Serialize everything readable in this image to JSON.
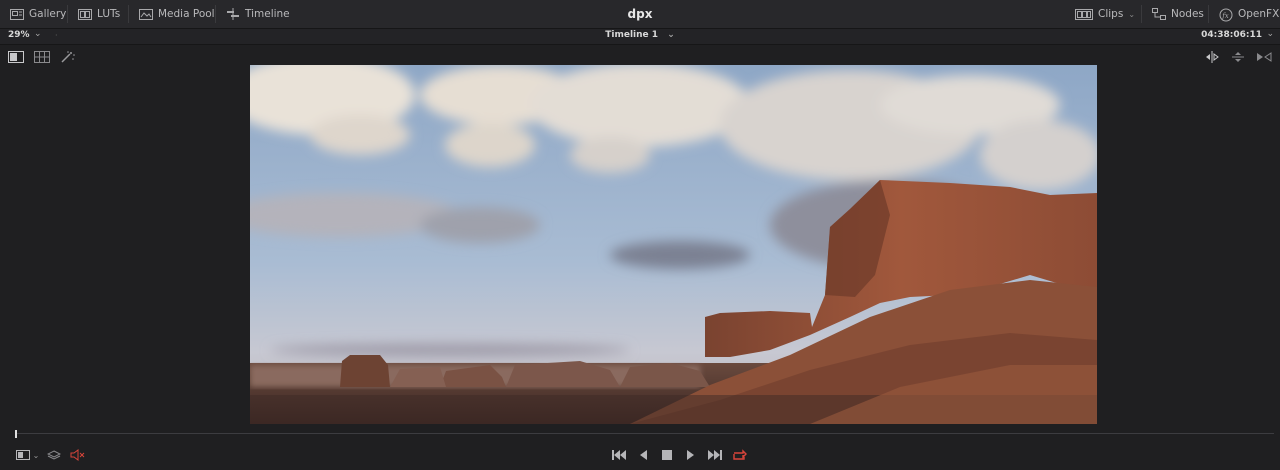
{
  "topbar": {
    "gallery_label": "Gallery",
    "luts_label": "LUTs",
    "media_pool_label": "Media Pool",
    "timeline_label": "Timeline",
    "project_title": "dpx",
    "clips_label": "Clips",
    "nodes_label": "Nodes",
    "openfx_label": "OpenFX"
  },
  "viewer_header": {
    "zoom": "29%",
    "timeline_name": "Timeline 1",
    "timecode": "04:38:06:11"
  },
  "colors": {
    "accent_red": "#d9453b",
    "background": "#1f1f21",
    "toolbar": "#28282b"
  },
  "icons": {
    "gallery": "gallery-icon",
    "luts": "luts-icon",
    "media_pool": "media-pool-icon",
    "timeline": "timeline-icon",
    "clips": "clips-icon",
    "nodes": "nodes-icon",
    "openfx": "fx-icon"
  },
  "playhead_position": 0.0
}
